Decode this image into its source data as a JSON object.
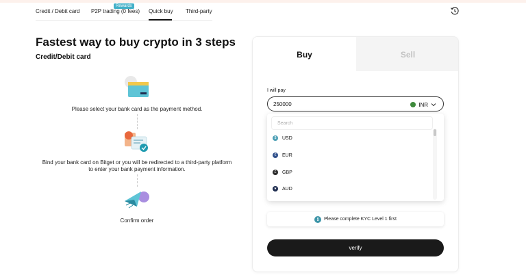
{
  "tabs": [
    {
      "label": "Credit / Debit card"
    },
    {
      "label": "P2P trading (0 fees)",
      "badge": "Rewards"
    },
    {
      "label": "Quick buy",
      "active": true
    },
    {
      "label": "Third-party"
    }
  ],
  "history_icon": "history-icon",
  "headline": "Fastest way to buy crypto in 3 steps",
  "subhead": "Credit/Debit card",
  "steps": [
    {
      "icon": "bank-card-illustration",
      "text": "Please select your bank card as the payment method."
    },
    {
      "icon": "bind-card-illustration",
      "text_line1": "Bind your bank card on Bitget or you will be redirected to a third-party platform",
      "text_line2": "to enter your bank payment information."
    },
    {
      "icon": "confirm-order-illustration",
      "text": "Confirm order"
    }
  ],
  "trade": {
    "buy_label": "Buy",
    "sell_label": "Sell",
    "pay_label": "I will pay",
    "pay_value": "250000",
    "currency": "INR",
    "currency_color": "#3e8a3c",
    "search_placeholder": "Search",
    "options": [
      {
        "code": "USD",
        "symbol": "$",
        "color": "#4c9fb5"
      },
      {
        "code": "EUR",
        "symbol": "€",
        "color": "#2f4f8a"
      },
      {
        "code": "GBP",
        "symbol": "£",
        "color": "#2a2a2a"
      },
      {
        "code": "AUD",
        "symbol": "★",
        "color": "#1f2d50"
      }
    ],
    "kyc_text": "Please complete KYC Level 1 first",
    "verify_label": "verify"
  }
}
